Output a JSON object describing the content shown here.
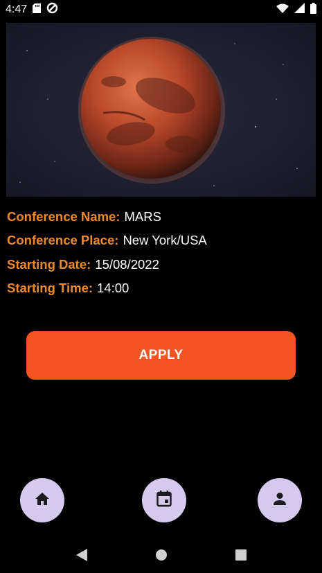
{
  "status_bar": {
    "time": "4:47",
    "icons": [
      "sd-card-icon",
      "data-saver-icon",
      "wifi-icon",
      "signal-icon",
      "battery-icon"
    ]
  },
  "hero": {
    "image": "mars-planet-image"
  },
  "details": {
    "name_label": "Conference Name:",
    "name_value": "MARS",
    "place_label": "Conference Place:",
    "place_value": "New York/USA",
    "date_label": "Starting Date:",
    "date_value": "15/08/2022",
    "time_label": "Starting Time:",
    "time_value": "14:00"
  },
  "apply_button": {
    "label": "APPLY"
  },
  "bottom_nav": {
    "items": [
      {
        "icon": "home-icon"
      },
      {
        "icon": "calendar-icon"
      },
      {
        "icon": "person-icon"
      }
    ]
  },
  "system_nav": {
    "icons": [
      "back-icon",
      "home-circle-icon",
      "recents-icon"
    ]
  },
  "colors": {
    "label_orange": "#ef8a2a",
    "apply_orange": "#f4541f",
    "nav_button_lavender": "#d6c9ee",
    "background": "#000000"
  }
}
